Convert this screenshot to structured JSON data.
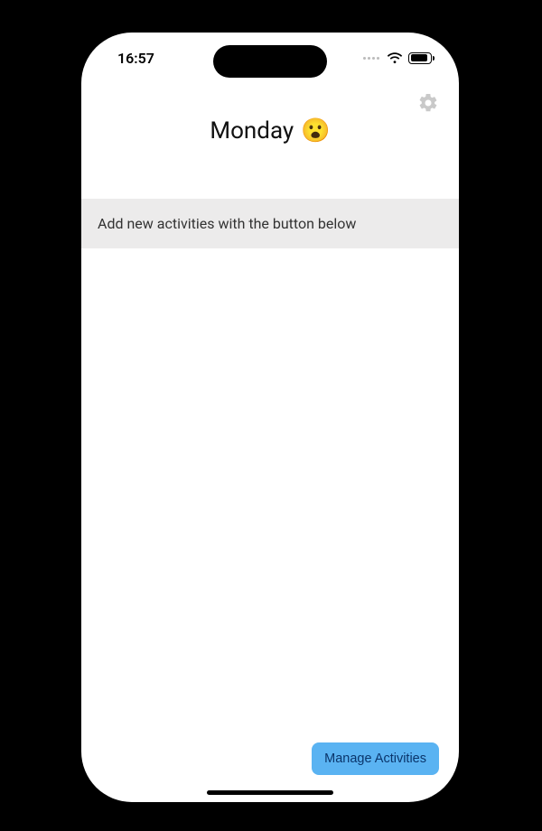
{
  "statusbar": {
    "time": "16:57"
  },
  "header": {
    "title": "Monday",
    "emoji": "😮"
  },
  "hint": {
    "text": "Add new activities with the button below"
  },
  "buttons": {
    "manage_activities": "Manage Activities"
  }
}
